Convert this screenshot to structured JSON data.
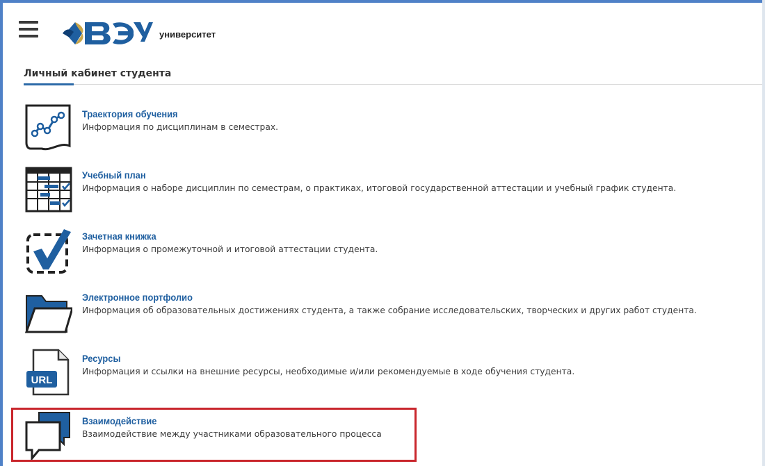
{
  "header": {
    "university_name": "университет",
    "logo_letters": "ВЭУ"
  },
  "cabinet": {
    "title": "Личный кабинет студента"
  },
  "items": [
    {
      "title": "Траектория обучения",
      "desc": "Информация по дисциплинам в семестрах.",
      "icon": "trajectory-chart-icon"
    },
    {
      "title": "Учебный план",
      "desc": "Информация о наборе дисциплин по семестрам, о практиках, итоговой государственной аттестации и учебный график студента.",
      "icon": "study-plan-table-icon"
    },
    {
      "title": "Зачетная книжка",
      "desc": "Информация о промежуточной и итоговой аттестации студента.",
      "icon": "checkmark-icon"
    },
    {
      "title": "Электронное портфолио",
      "desc": "Информация об образовательных достижениях студента, а также собрание исследовательских, творческих и других работ студента.",
      "icon": "folder-icon"
    },
    {
      "title": "Ресурсы",
      "desc": "Информация и ссылки на внешние ресурсы, необходимые и/или рекомендуемые в ходе обучения студента.",
      "icon": "url-document-icon",
      "icon_label": "URL"
    },
    {
      "title": "Взаимодействие",
      "desc": "Взаимодействие между участниками образовательного процесса",
      "icon": "chat-bubbles-icon",
      "highlighted": true
    }
  ],
  "colors": {
    "accent": "#1f5fa0",
    "highlight": "#c9262c",
    "logo_gold": "#c9a64a"
  }
}
